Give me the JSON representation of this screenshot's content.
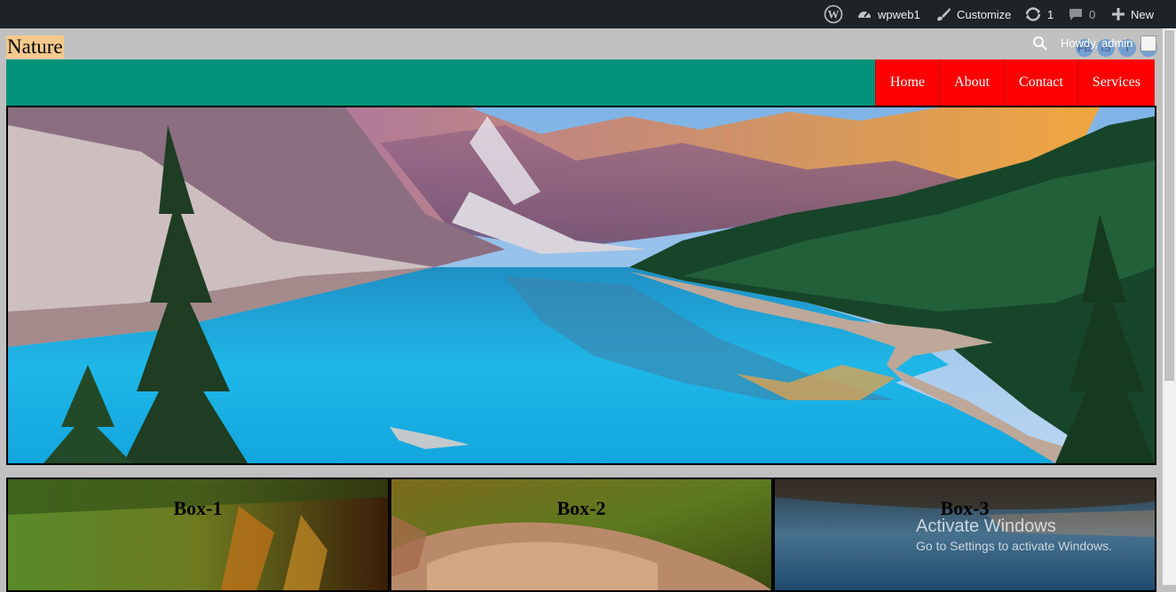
{
  "admin_bar": {
    "site_name": "wpweb1",
    "customize_label": "Customize",
    "updates_count": "1",
    "comments_count": "0",
    "new_label": "New",
    "howdy": "Howdy, admin",
    "icons": [
      "wordpress-logo-icon",
      "dashboard-icon",
      "brush-icon",
      "updates-icon",
      "comment-icon",
      "plus-icon",
      "search-icon"
    ]
  },
  "header": {
    "site_title": "Nature",
    "social": [
      "FB",
      "IS",
      "T",
      "..."
    ]
  },
  "nav": {
    "items": [
      {
        "label": "Home"
      },
      {
        "label": "About"
      },
      {
        "label": "Contact"
      },
      {
        "label": "Services"
      }
    ]
  },
  "boxes": [
    {
      "title": "Box-1"
    },
    {
      "title": "Box-2"
    },
    {
      "title": "Box-3"
    }
  ],
  "watermark": {
    "title": "Activate Windows",
    "subtitle": "Go to Settings to activate Windows."
  },
  "colors": {
    "admin_bar": "#1d2327",
    "page_bg": "#c0c0c0",
    "nav_bg": "#009379",
    "nav_item_bg": "#ff0000",
    "title_bg": "#f5c98c"
  }
}
